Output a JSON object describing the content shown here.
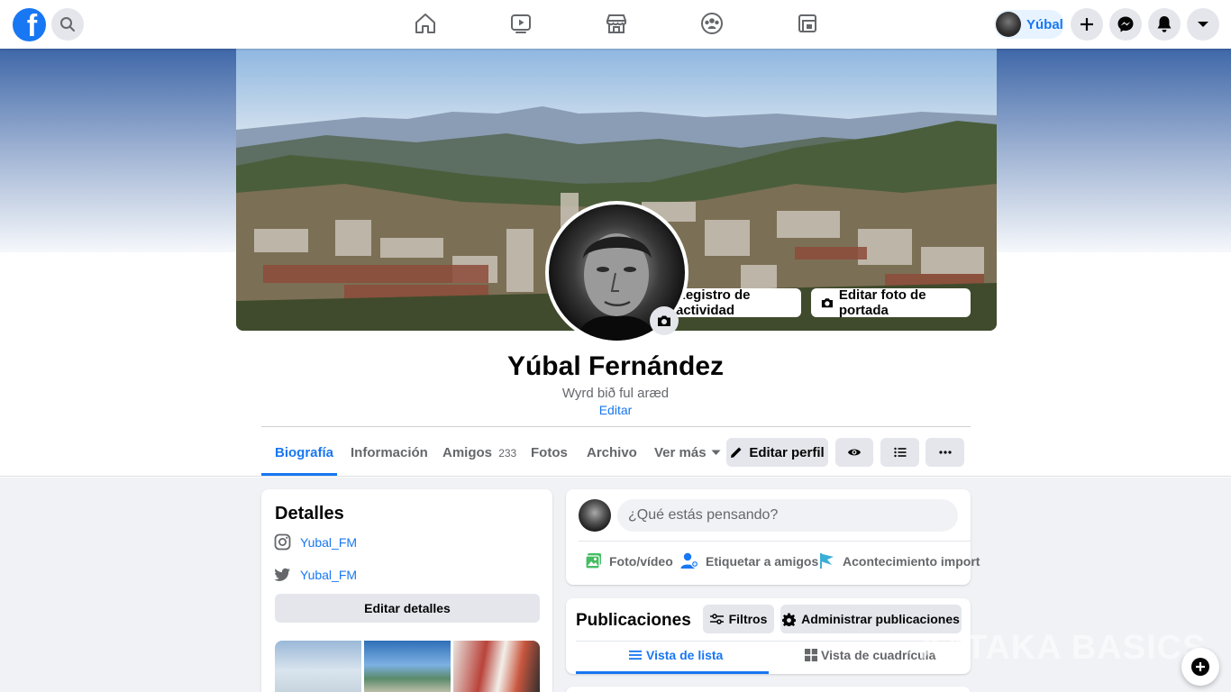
{
  "topbar": {
    "logo_icon": "facebook-logo-icon",
    "search_icon": "search-icon",
    "nav_items": [
      {
        "name": "home",
        "icon": "home-icon"
      },
      {
        "name": "watch",
        "icon": "video-icon"
      },
      {
        "name": "marketplace",
        "icon": "shop-icon"
      },
      {
        "name": "groups",
        "icon": "groups-icon"
      },
      {
        "name": "gaming",
        "icon": "gaming-icon"
      }
    ],
    "profile_name": "Yúbal",
    "right_icons": [
      "plus-icon",
      "messenger-icon",
      "bell-icon",
      "caret-down-icon"
    ]
  },
  "cover": {
    "activity_log_label": "Registro de actividad",
    "edit_cover_label": "Editar foto de portada"
  },
  "profile": {
    "name": "Yúbal Fernández",
    "bio": "Wyrd bið ful aræd",
    "edit_label": "Editar"
  },
  "tabs": {
    "items": [
      {
        "label": "Biografía",
        "active": true
      },
      {
        "label": "Información"
      },
      {
        "label": "Amigos"
      },
      {
        "label": "Fotos"
      },
      {
        "label": "Archivo"
      },
      {
        "label": "Ver más"
      }
    ],
    "friends_count": "233",
    "edit_profile_label": "Editar perfil"
  },
  "details": {
    "title": "Detalles",
    "instagram": "Yubal_FM",
    "twitter": "Yubal_FM",
    "edit_button": "Editar detalles"
  },
  "composer": {
    "placeholder": "¿Qué estás pensando?",
    "actions": [
      {
        "label": "Foto/vídeo",
        "icon": "photo-icon",
        "color": "#45bd62"
      },
      {
        "label": "Etiquetar a amigos",
        "icon": "tag-friends-icon",
        "color": "#1877f2"
      },
      {
        "label": "Acontecimiento import",
        "icon": "flag-icon",
        "color": "#39afd5"
      }
    ]
  },
  "publications": {
    "title": "Publicaciones",
    "filters_label": "Filtros",
    "manage_label": "Administrar publicaciones",
    "list_view_label": "Vista de lista",
    "grid_view_label": "Vista de cuadrícula"
  },
  "watermark": "XATAKA BASICS",
  "colors": {
    "accent": "#1877f2",
    "background": "#f0f2f5",
    "button_gray": "#e4e6eb",
    "text_secondary": "#65676b"
  }
}
